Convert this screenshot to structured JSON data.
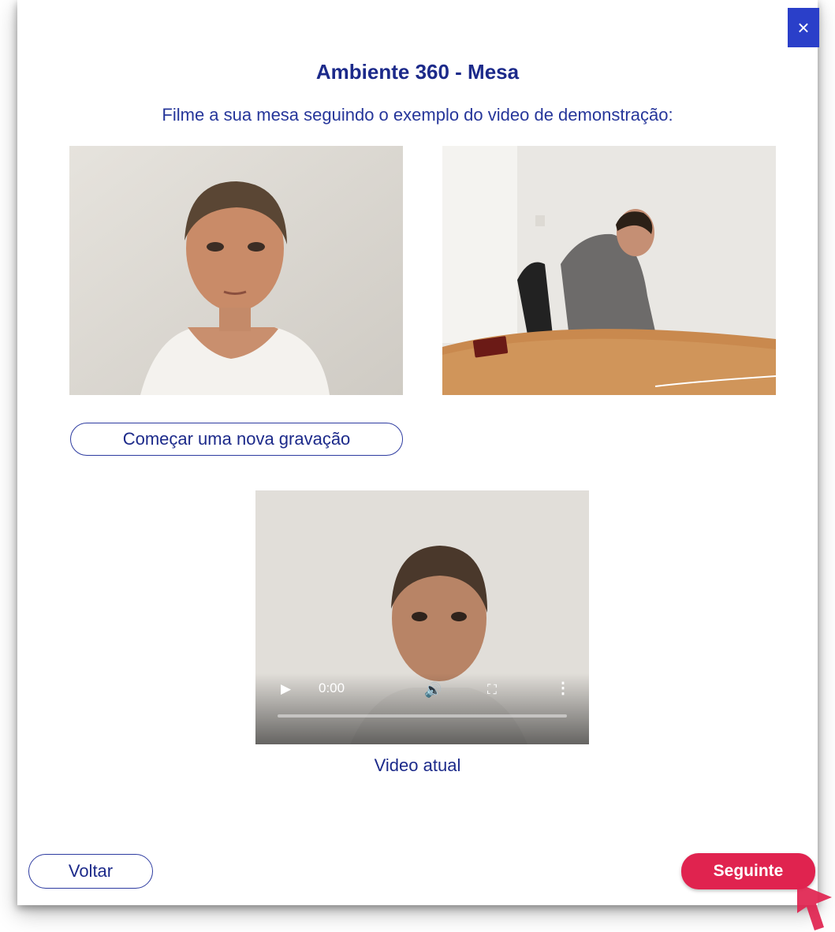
{
  "dialog": {
    "title": "Ambiente 360 - Mesa",
    "subtitle": "Filme a sua mesa seguindo o exemplo do video de demonstração:",
    "close_icon": "×"
  },
  "buttons": {
    "new_recording": "Começar uma nova gravação",
    "back": "Voltar",
    "next": "Seguinte"
  },
  "current_video": {
    "caption": "Video atual",
    "time": "0:00",
    "progress": 0,
    "icons": {
      "play": "▶",
      "volume": "🔊",
      "fullscreen": "⛶",
      "more": "⋮"
    }
  },
  "colors": {
    "title": "#1c2a8a",
    "accent": "#2a3fc9",
    "next_button": "#e0234f"
  }
}
